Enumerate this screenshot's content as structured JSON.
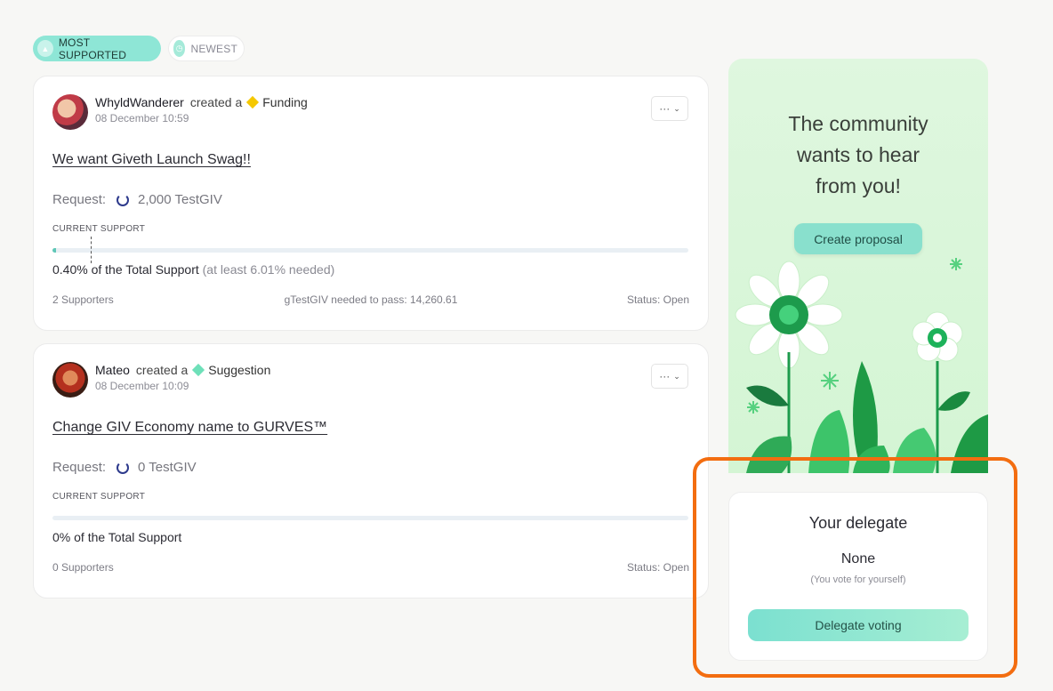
{
  "sort_tabs": [
    {
      "label": "MOST SUPPORTED",
      "active": true
    },
    {
      "label": "NEWEST",
      "active": false
    }
  ],
  "proposals": [
    {
      "author": "WhyldWanderer",
      "created_text": "created a",
      "type": "Funding",
      "type_color": "#f5c800",
      "date": "08 December 10:59",
      "title": "We want Giveth Launch Swag!!",
      "request_label": "Request:",
      "request_amount": "2,000 TestGIV",
      "support_label": "CURRENT SUPPORT",
      "support_fraction": 0.004,
      "threshold_fraction": 0.0601,
      "support_text": "0.40% of the Total Support",
      "support_note": "(at least 6.01% needed)",
      "supporters": "2 Supporters",
      "needed": "gTestGIV needed to pass: 14,260.61",
      "status": "Status: Open"
    },
    {
      "author": "Mateo",
      "created_text": "created a",
      "type": "Suggestion",
      "type_color": "#6ee0b9",
      "date": "08 December 10:09",
      "title": "Change GIV Economy name to GURVES™",
      "request_label": "Request:",
      "request_amount": "0 TestGIV",
      "support_label": "CURRENT SUPPORT",
      "support_fraction": 0,
      "support_text": "0% of the Total Support",
      "supporters": "0 Supporters",
      "status": "Status: Open"
    }
  ],
  "promo": {
    "title": "The community wants to hear from you!",
    "button": "Create proposal"
  },
  "delegate": {
    "title": "Your delegate",
    "name": "None",
    "note": "(You vote for yourself)",
    "button": "Delegate voting"
  },
  "colors": {
    "accent": "#89e0cd",
    "highlight": "#f36d10"
  }
}
